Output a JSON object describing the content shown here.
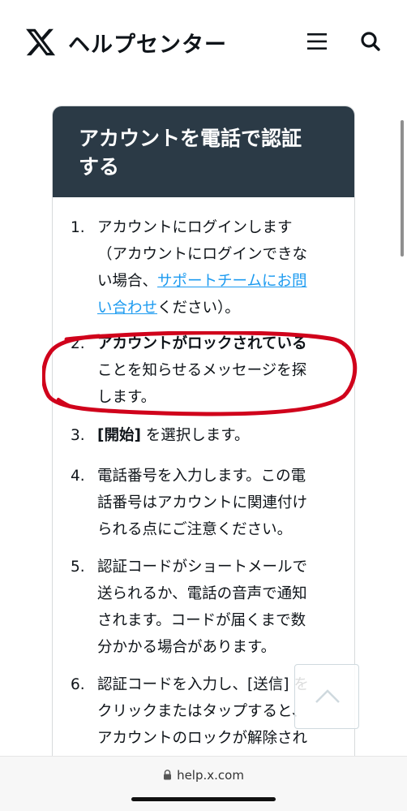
{
  "header": {
    "site_title": "ヘルプセンター",
    "icons": [
      "x-logo-icon",
      "menu-icon",
      "search-icon"
    ]
  },
  "article": {
    "title_line1": "アカウントを電話で認証",
    "title_line2": "する",
    "steps": [
      {
        "number": "1.",
        "line1": "アカウントにログインします",
        "line2": "（アカウントにログインできな",
        "line3_prefix": "い場合、",
        "link_part1": "サポートチームにお問",
        "link_part2": "い合わせ",
        "line4_suffix": "ください）。"
      },
      {
        "number": "2.",
        "bold_text": "アカウントがロックされている",
        "line2": "ことを知らせるメッセージを探",
        "line3": "します。"
      },
      {
        "number": "3.",
        "bold_text": "[開始]",
        "text": " を選択します。"
      },
      {
        "number": "4.",
        "line1": "電話番号を入力します。この電",
        "line2": "話番号はアカウントに関連付け",
        "line3": "られる点にご注意ください。"
      },
      {
        "number": "5.",
        "line1": "認証コードがショートメールで",
        "line2": "送られるか、電話の音声で通知",
        "line3": "されます。コードが届くまで数",
        "line4": "分かかる場合があります。"
      },
      {
        "number": "6.",
        "line1": "認証コードを入力し、[送信] を",
        "line2": "クリックまたはタップすると、",
        "line3": "アカウントのロックが解除され"
      }
    ]
  },
  "browser": {
    "url": "help.x.com"
  },
  "colors": {
    "header_bg": "#2b3a46",
    "link": "#1d9bf0",
    "annotation": "#d0021b"
  }
}
